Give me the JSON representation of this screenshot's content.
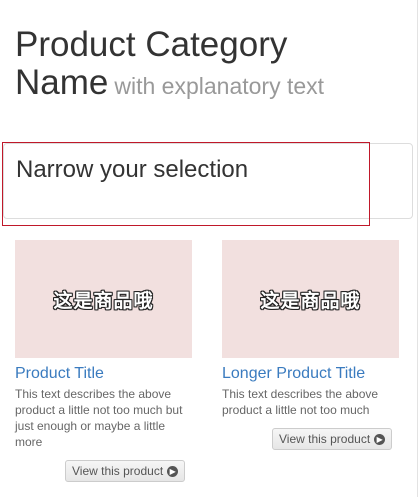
{
  "header": {
    "title": "Product Category Name",
    "subtitle": "with explanatory text"
  },
  "filter_panel": {
    "title": "Narrow your selection"
  },
  "products": [
    {
      "image_text": "这是商品哦",
      "title": "Product Title",
      "description": "This text describes the above product a little not too much but just enough or maybe a little more",
      "button_label": "View this product"
    },
    {
      "image_text": "这是商品哦",
      "title": "Longer Product Title",
      "description": "This text describes the above product a little not too much",
      "button_label": "View this product"
    }
  ],
  "colors": {
    "link": "#3a7bbf",
    "image_bg": "#f2e0df",
    "highlight": "#c0182a"
  }
}
